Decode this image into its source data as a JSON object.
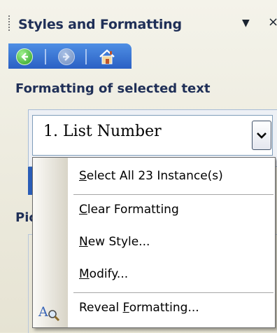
{
  "pane": {
    "title": "Styles and Formatting",
    "title_menu_icon": "dropdown-arrow-icon",
    "close_icon": "close-icon"
  },
  "nav": {
    "back_icon": "back-arrow-icon",
    "forward_icon": "forward-arrow-icon",
    "home_icon": "home-icon"
  },
  "formatting_section": {
    "heading": "Formatting of selected text",
    "selected_style": "1.  List Number",
    "dropdown_icon": "chevron-down-icon"
  },
  "hidden_label_fragment": "Pick formatting to apply",
  "context_menu": {
    "items": [
      {
        "before": "",
        "mnemonic": "S",
        "after": "elect All 23 Instance(s)"
      },
      {
        "before": "",
        "mnemonic": "C",
        "after": "lear Formatting"
      },
      {
        "before": "",
        "mnemonic": "N",
        "after": "ew Style..."
      },
      {
        "before": "",
        "mnemonic": "M",
        "after": "odify..."
      },
      {
        "before": "Reveal ",
        "mnemonic": "F",
        "after": "ormatting...",
        "icon": "reveal-formatting-icon"
      }
    ]
  },
  "colors": {
    "title_text": "#1f2f57",
    "nav_bar": "#2b60c4",
    "pane_background": "#ebe9d8",
    "menu_border": "#6b6b6b"
  }
}
